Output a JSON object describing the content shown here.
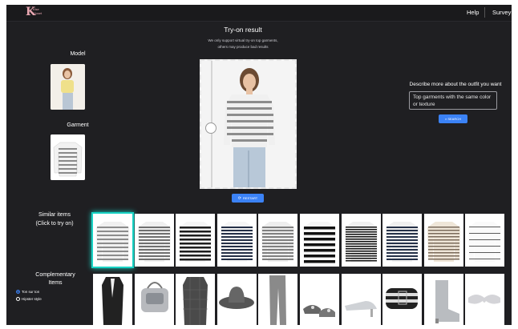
{
  "header": {
    "logo_line1": "Kise",
    "logo_line2": "Kloset",
    "help": "Help",
    "survey": "Survey"
  },
  "left": {
    "model_label": "Model",
    "garment_label": "Garment"
  },
  "tryon": {
    "title": "Try-on result",
    "note_line1": "We only support virtual try-on top garments,",
    "note_line2": "others may produce bad results",
    "restart_label": "RESTART"
  },
  "describe": {
    "label": "Describe more about the outfit you want",
    "input_value": "Top garments with the same color or texture",
    "search_label": "SEARCH"
  },
  "similar": {
    "label_line1": "Similar items",
    "label_line2": "(Click to try on)",
    "items": [
      "grey striped long-sleeve top (selected)",
      "grey striped top",
      "black striped top",
      "navy striped top",
      "grey striped top",
      "black wide-stripe top",
      "black stripe top",
      "navy stripe top",
      "beige striped top",
      "white check top"
    ]
  },
  "complementary": {
    "label_line1": "Complementary",
    "label_line2": "Items",
    "options": [
      "Ton sur ton",
      "Hipster style"
    ],
    "selected": "Ton sur ton",
    "items": [
      "black blazer",
      "silver bag",
      "grey plaid blazer",
      "grey hat",
      "grey trousers",
      "grey heels",
      "silver pump",
      "striped cuff",
      "silver boots",
      "sunglasses"
    ]
  },
  "colors": {
    "accent": "#3b82f6",
    "highlight": "#19d3c5",
    "background": "#1f1f22"
  }
}
